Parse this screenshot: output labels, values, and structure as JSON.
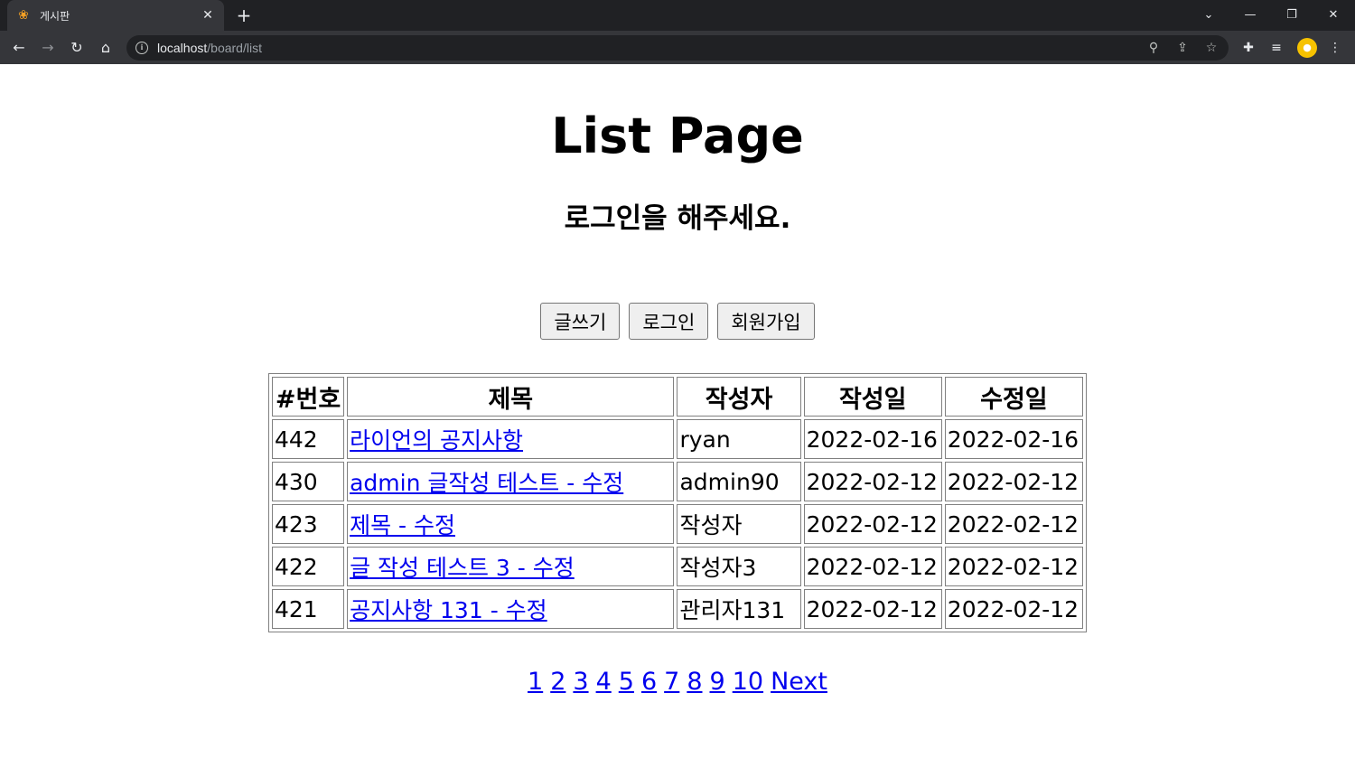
{
  "browser": {
    "tab_title": "게시판",
    "tab_icon": "paw-icon",
    "url_host": "localhost",
    "url_path": "/board/list"
  },
  "page": {
    "title": "List Page",
    "login_message": "로그인을 해주세요."
  },
  "buttons": {
    "write": "글쓰기",
    "login": "로그인",
    "signup": "회원가입"
  },
  "table": {
    "headers": [
      "#번호",
      "제목",
      "작성자",
      "작성일",
      "수정일"
    ],
    "rows": [
      {
        "no": "442",
        "title": "라이언의 공지사항",
        "writer": "ryan",
        "created": "2022-02-16",
        "updated": "2022-02-16"
      },
      {
        "no": "430",
        "title": "admin 글작성 테스트 - 수정",
        "writer": "admin90",
        "created": "2022-02-12",
        "updated": "2022-02-12"
      },
      {
        "no": "423",
        "title": "제목 - 수정",
        "writer": "작성자",
        "created": "2022-02-12",
        "updated": "2022-02-12"
      },
      {
        "no": "422",
        "title": "글 작성 테스트 3 - 수정",
        "writer": "작성자3",
        "created": "2022-02-12",
        "updated": "2022-02-12"
      },
      {
        "no": "421",
        "title": "공지사항 131 - 수정",
        "writer": "관리자131",
        "created": "2022-02-12",
        "updated": "2022-02-12"
      }
    ]
  },
  "pagination": {
    "pages": [
      "1",
      "2",
      "3",
      "4",
      "5",
      "6",
      "7",
      "8",
      "9",
      "10"
    ],
    "next": "Next"
  },
  "colors": {
    "link": "#0000ee",
    "chrome_dark": "#202124",
    "chrome_toolbar": "#35363a"
  }
}
